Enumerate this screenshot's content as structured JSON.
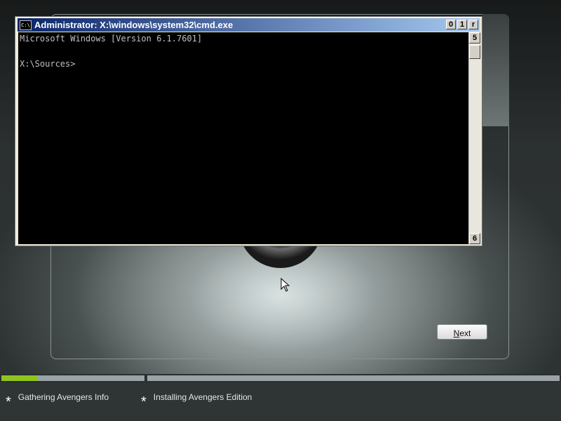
{
  "cmd": {
    "icon_text": "C:\\",
    "title": "Administrator: X:\\windows\\system32\\cmd.exe",
    "buttons": [
      "0",
      "1",
      "r"
    ],
    "scroll_up_glyph": "5",
    "scroll_down_glyph": "6",
    "console_lines": [
      "Microsoft Windows [Version 6.1.7601]",
      "",
      "X:\\Sources>"
    ]
  },
  "setup": {
    "next_label_u": "N",
    "next_label_rest": "ext"
  },
  "progress": {
    "fraction": 0.25
  },
  "steps": [
    {
      "star": "*",
      "label": "Gathering Avengers Info"
    },
    {
      "star": "*",
      "label": "Installing Avengers Edition"
    }
  ],
  "colors": {
    "progress_fill": "#8fc41f",
    "titlebar_start": "#0a246a",
    "titlebar_end": "#a6caf0"
  }
}
